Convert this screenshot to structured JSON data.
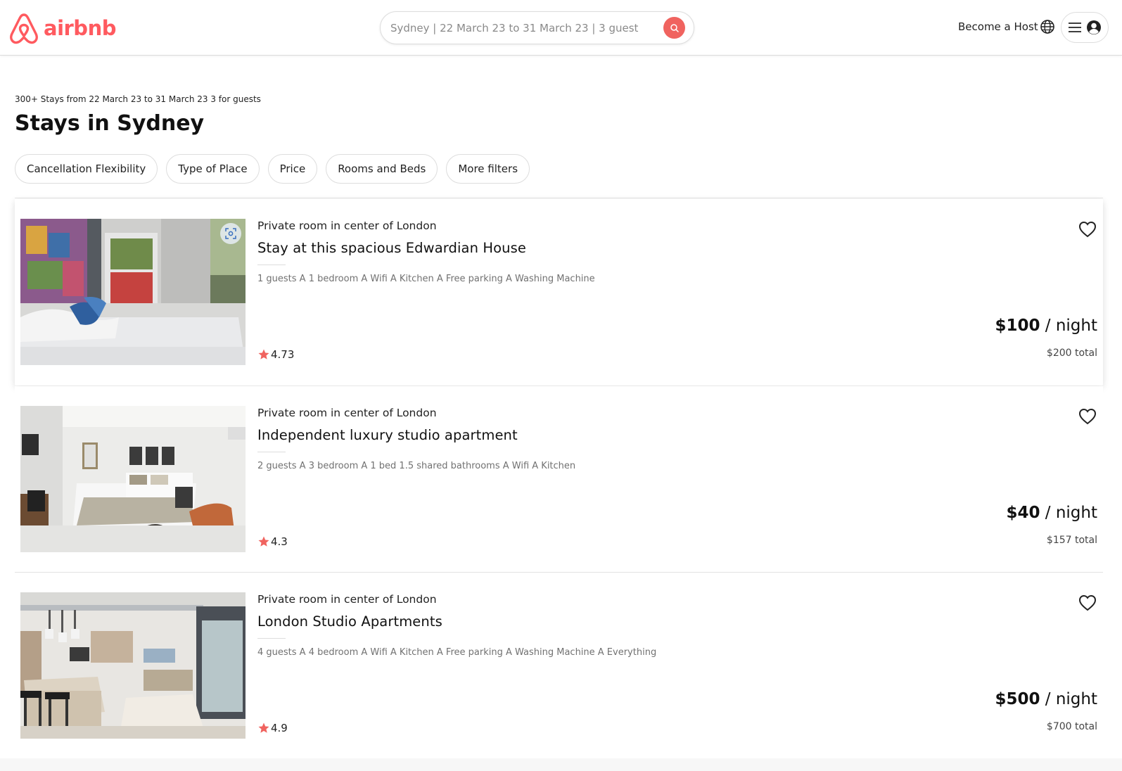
{
  "brand": {
    "name": "airbnb",
    "color": "#ff5a5f"
  },
  "search": {
    "placeholder": "Sydney | 22 March 23 to 31 March 23 | 3 guest",
    "button_icon": "search-icon",
    "button_color": "#f0635f"
  },
  "header": {
    "host_label": "Become a Host",
    "globe_icon": "globe-icon",
    "menu_icon": "hamburger-menu-icon",
    "avatar_icon": "user-avatar-icon"
  },
  "results": {
    "summary": "300+ Stays from 22 March 23 to 31 March 23 3 for guests",
    "title": "Stays in Sydney"
  },
  "filters": [
    {
      "label": "Cancellation Flexibility"
    },
    {
      "label": "Type of Place"
    },
    {
      "label": "Price"
    },
    {
      "label": "Rooms and Beds"
    },
    {
      "label": "More filters"
    }
  ],
  "listings": [
    {
      "subtitle": "Private room in center of London",
      "title": "Stay at this spacious Edwardian House",
      "amenities": "1 guests A 1 bedroom A Wifi A Kitchen A Free parking A Washing Machine",
      "rating": "4.73",
      "price": "$100",
      "price_unit": " / night",
      "total": "$200 total",
      "highlighted": true
    },
    {
      "subtitle": "Private room in center of London",
      "title": "Independent luxury studio apartment",
      "amenities": "2 guests A 3 bedroom A 1 bed 1.5 shared bathrooms A Wifi A Kitchen",
      "rating": "4.3",
      "price": "$40",
      "price_unit": " / night",
      "total": "$157 total",
      "highlighted": false
    },
    {
      "subtitle": "Private room in center of London",
      "title": "London Studio Apartments",
      "amenities": "4 guests A 4 bedroom A Wifi A Kitchen A Free parking A Washing Machine A Everything",
      "rating": "4.9",
      "price": "$500",
      "price_unit": " / night",
      "total": "$700 total",
      "highlighted": false
    }
  ],
  "colors": {
    "accent": "#ff5a5f",
    "star": "#f0635f"
  }
}
